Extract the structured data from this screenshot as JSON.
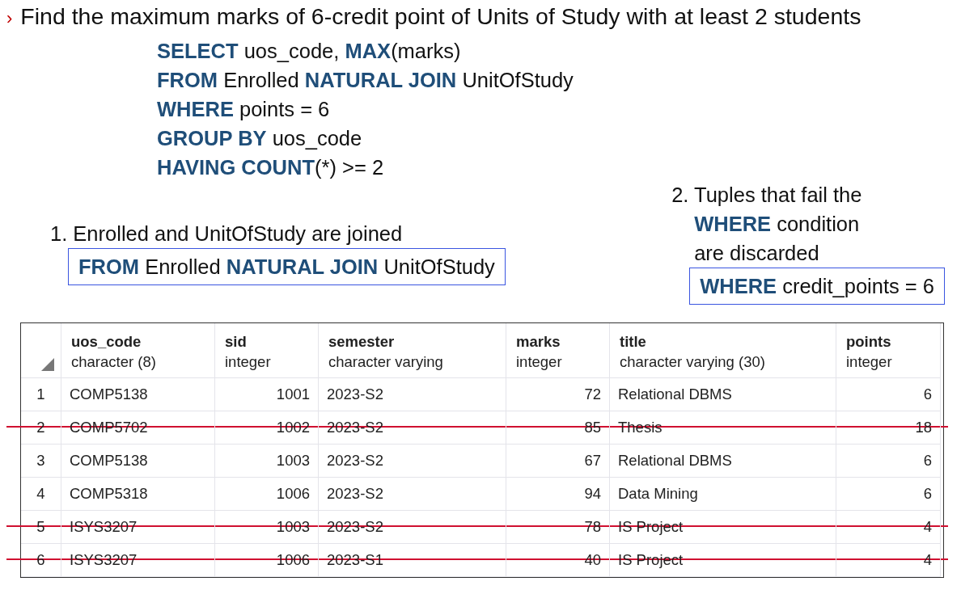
{
  "question": {
    "marker": "›",
    "text": "Find the maximum marks of 6-credit point of Units of Study with at least 2 students"
  },
  "query_lines": [
    "**SELECT** uos_code, **MAX**(marks)",
    "**FROM** Enrolled **NATURAL JOIN** UnitOfStudy",
    "**WHERE** points = 6",
    "**GROUP BY** uos_code",
    "**HAVING COUNT**(*) >= 2"
  ],
  "annotations": [
    {
      "lines": [
        "1. Enrolled and UnitOfStudy are joined"
      ],
      "clause": "**FROM** Enrolled **NATURAL JOIN** UnitOfStudy"
    },
    {
      "lines": [
        "2. Tuples that fail the",
        "**WHERE** condition",
        "are discarded"
      ],
      "clause": "**WHERE** credit_points = 6"
    }
  ],
  "table": {
    "columns": [
      {
        "name": "uos_code",
        "type": "character (8)",
        "kind": "text"
      },
      {
        "name": "sid",
        "type": "integer",
        "kind": "number"
      },
      {
        "name": "semester",
        "type": "character varying",
        "kind": "text"
      },
      {
        "name": "marks",
        "type": "integer",
        "kind": "number"
      },
      {
        "name": "title",
        "type": "character varying (30)",
        "kind": "text"
      },
      {
        "name": "points",
        "type": "integer",
        "kind": "number"
      }
    ],
    "rows": [
      {
        "number": "1",
        "cells": [
          "COMP5138",
          "1001",
          "2023-S2",
          "72",
          "Relational DBMS",
          "6"
        ],
        "discarded": false
      },
      {
        "number": "2",
        "cells": [
          "COMP5702",
          "1002",
          "2023-S2",
          "85",
          "Thesis",
          "18"
        ],
        "discarded": true
      },
      {
        "number": "3",
        "cells": [
          "COMP5138",
          "1003",
          "2023-S2",
          "67",
          "Relational DBMS",
          "6"
        ],
        "discarded": false
      },
      {
        "number": "4",
        "cells": [
          "COMP5318",
          "1006",
          "2023-S2",
          "94",
          "Data Mining",
          "6"
        ],
        "discarded": false
      },
      {
        "number": "5",
        "cells": [
          "ISYS3207",
          "1003",
          "2023-S2",
          "78",
          "IS Project",
          "4"
        ],
        "discarded": true
      },
      {
        "number": "6",
        "cells": [
          "ISYS3207",
          "1006",
          "2023-S1",
          "40",
          "IS Project",
          "4"
        ],
        "discarded": true
      }
    ]
  }
}
